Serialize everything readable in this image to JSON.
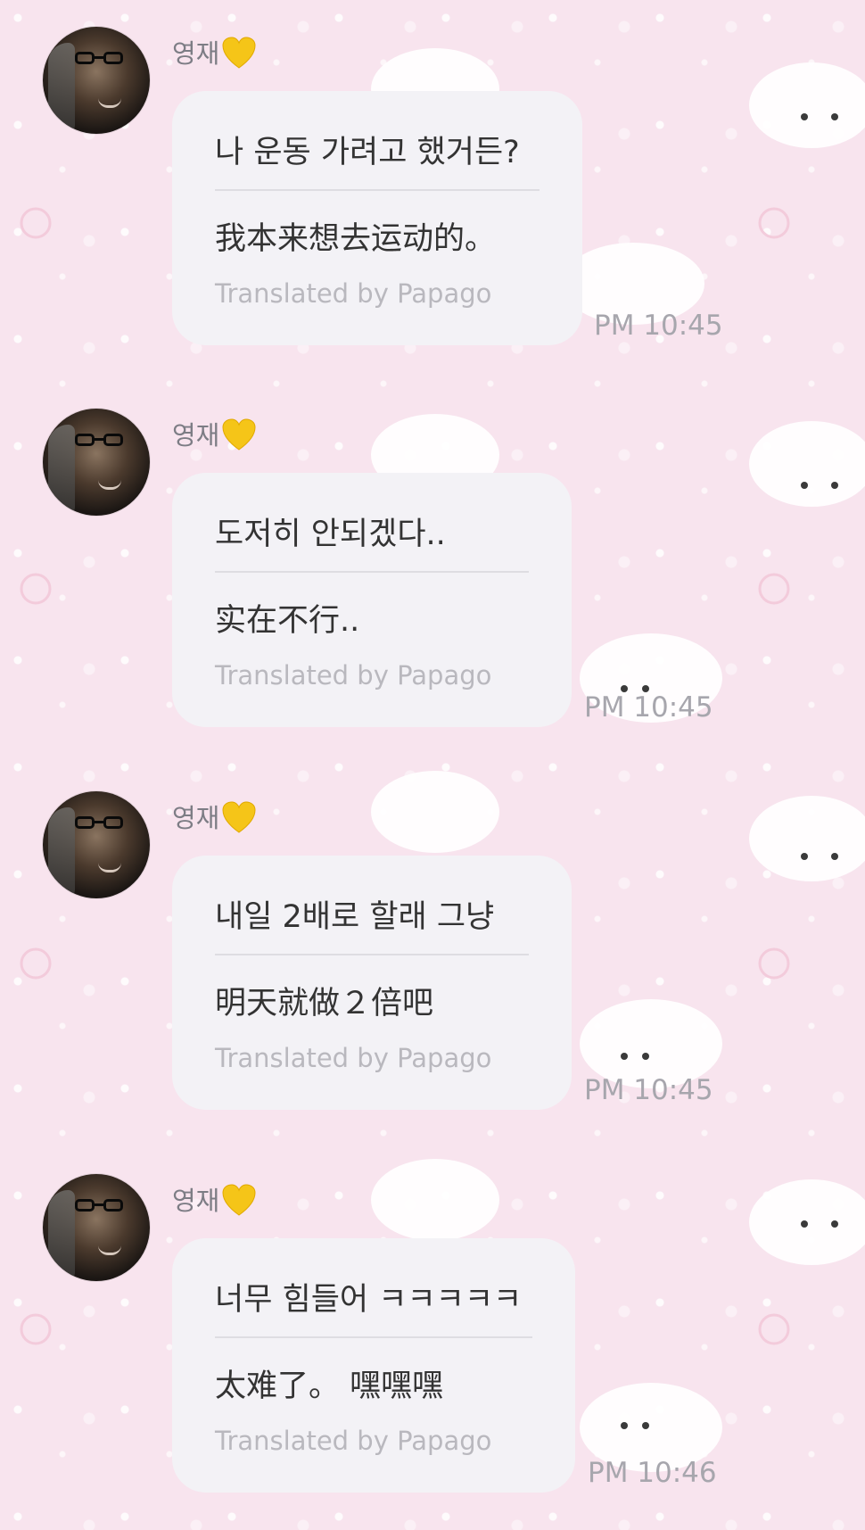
{
  "chat": {
    "messages": [
      {
        "sender": "영재",
        "original": "나 운동 가려고 했거든?",
        "translated": "我本来想去运动的。",
        "credit": "Translated by Papago",
        "time": "PM 10:45"
      },
      {
        "sender": "영재",
        "original": "도저히 안되겠다..",
        "translated": "实在不行..",
        "credit": "Translated by Papago",
        "time": "PM 10:45"
      },
      {
        "sender": "영재",
        "original": "내일 2배로 할래 그냥",
        "translated": "明天就做２倍吧",
        "credit": "Translated by Papago",
        "time": "PM 10:45"
      },
      {
        "sender": "영재",
        "original": "너무 힘들어 ㅋㅋㅋㅋㅋ",
        "translated": "太难了。 嘿嘿嘿",
        "credit": "Translated by Papago",
        "time": "PM 10:46"
      }
    ]
  },
  "theme": {
    "background": "#f8e4ee",
    "bubble": "#f3f2f6",
    "heart": "#f5c518",
    "text": "#333333",
    "muted": "#b9b8be"
  },
  "icons": {
    "heart": "yellow-heart-emoji"
  }
}
